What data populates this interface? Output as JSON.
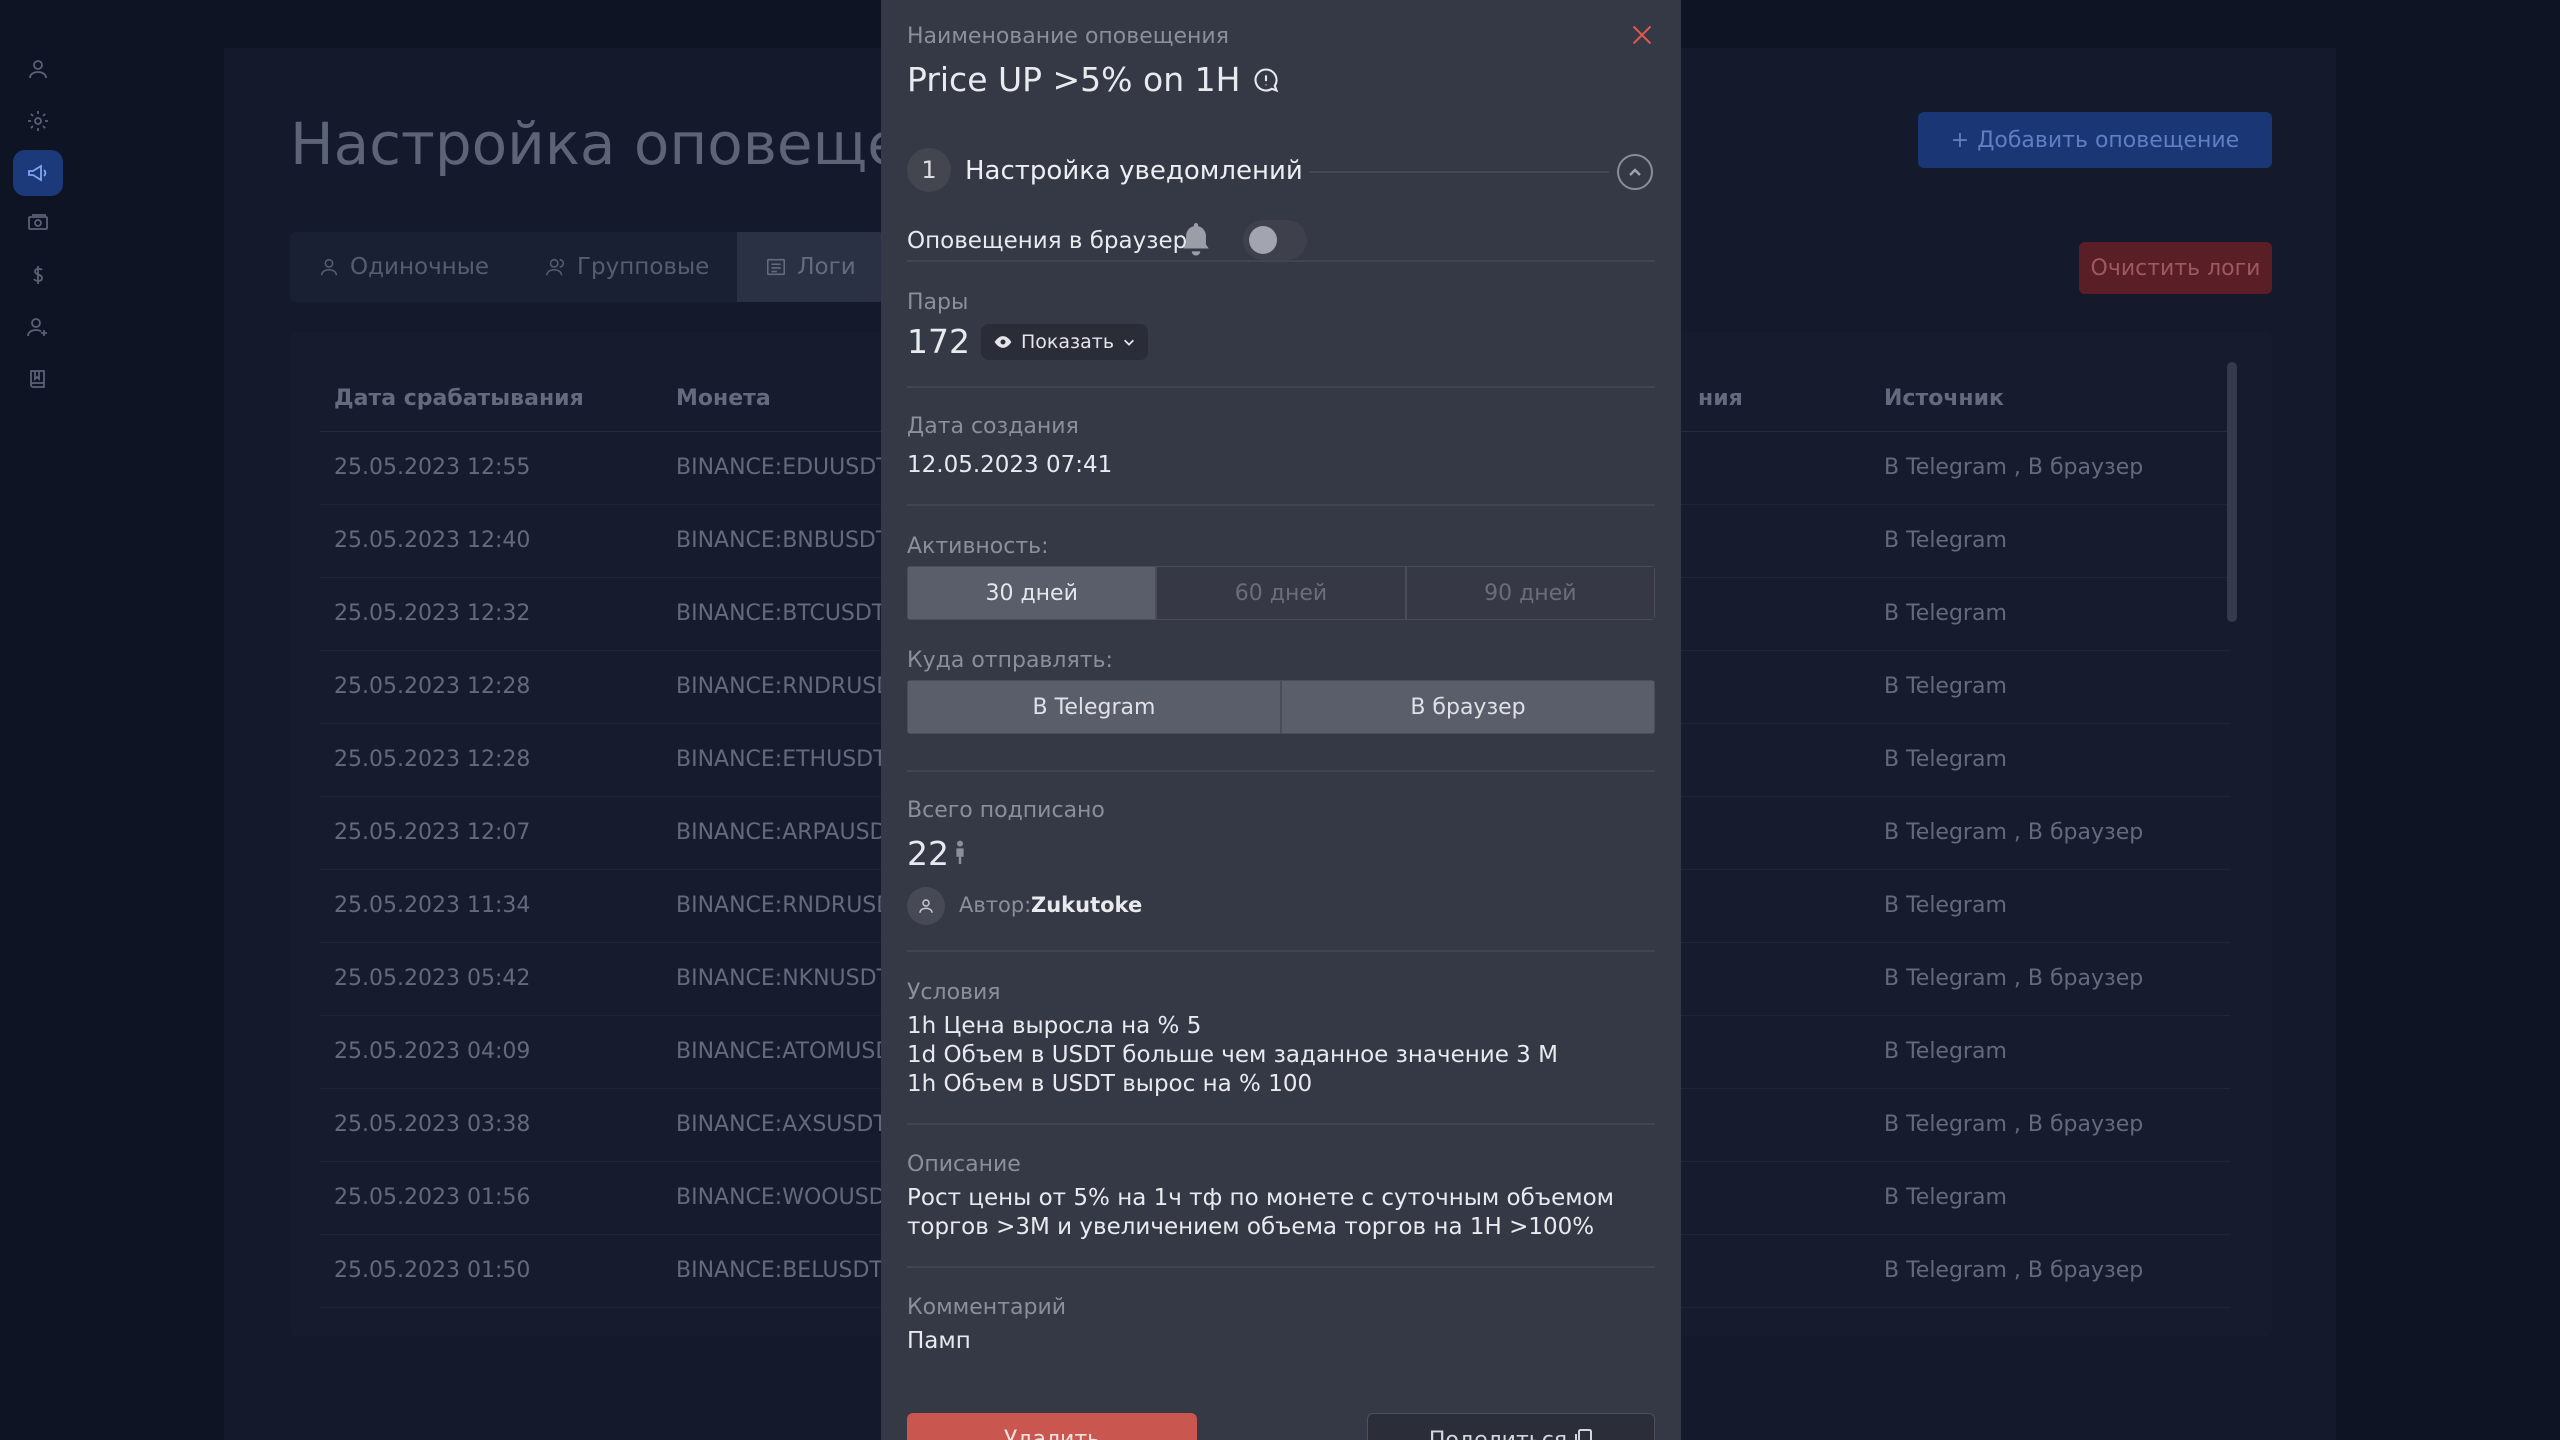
{
  "sidebar": {
    "items": [
      {
        "icon": "user-icon"
      },
      {
        "icon": "gear-icon"
      },
      {
        "icon": "megaphone-icon",
        "active": true
      },
      {
        "icon": "cash-icon"
      },
      {
        "icon": "dollar-icon"
      },
      {
        "icon": "add-user-icon"
      },
      {
        "icon": "book-icon"
      }
    ]
  },
  "page": {
    "title": "Настройка оповещен",
    "add_button": "Добавить оповещение",
    "clear_button": "Очистить логи",
    "tabs": [
      {
        "label": "Одиночные",
        "icon": "user-icon"
      },
      {
        "label": "Групповые",
        "icon": "users-icon"
      },
      {
        "label": "Логи",
        "icon": "list-icon",
        "active": true
      }
    ]
  },
  "table": {
    "headers": {
      "date": "Дата срабатывания",
      "coin": "Монета",
      "partial": "ния",
      "source": "Источник"
    },
    "rows": [
      {
        "date": "25.05.2023 12:55",
        "coin": "BINANCE:EDUUSDT",
        "source": "В Telegram , В браузер"
      },
      {
        "date": "25.05.2023 12:40",
        "coin": "BINANCE:BNBUSDT",
        "source": "В Telegram"
      },
      {
        "date": "25.05.2023 12:32",
        "coin": "BINANCE:BTCUSDT",
        "source": "В Telegram"
      },
      {
        "date": "25.05.2023 12:28",
        "coin": "BINANCE:RNDRUSDT",
        "source": "В Telegram"
      },
      {
        "date": "25.05.2023 12:28",
        "coin": "BINANCE:ETHUSDT",
        "source": "В Telegram"
      },
      {
        "date": "25.05.2023 12:07",
        "coin": "BINANCE:ARPAUSDT",
        "source": "В Telegram , В браузер"
      },
      {
        "date": "25.05.2023 11:34",
        "coin": "BINANCE:RNDRUSDT",
        "source": "В Telegram"
      },
      {
        "date": "25.05.2023 05:42",
        "coin": "BINANCE:NKNUSDT",
        "source": "В Telegram , В браузер"
      },
      {
        "date": "25.05.2023 04:09",
        "coin": "BINANCE:ATOMUSDT",
        "source": "В Telegram"
      },
      {
        "date": "25.05.2023 03:38",
        "coin": "BINANCE:AXSUSDT",
        "source": "В Telegram , В браузер"
      },
      {
        "date": "25.05.2023 01:56",
        "coin": "BINANCE:WOOUSDT",
        "source": "В Telegram"
      },
      {
        "date": "25.05.2023 01:50",
        "coin": "BINANCE:BELUSDT",
        "source": "В Telegram , В браузер"
      }
    ]
  },
  "modal": {
    "name_label": "Наименование оповещения",
    "name": "Price UP >5% on 1H",
    "step_number": "1",
    "step_title": "Настройка уведомлений",
    "browser_alerts_label": "Оповещения в браузере",
    "browser_alerts_on": false,
    "pairs_label": "Пары",
    "pairs_count": "172",
    "show_button": "Показать",
    "created_label": "Дата создания",
    "created_value": "12.05.2023 07:41",
    "activity_label": "Активность:",
    "activity_options": [
      "30 дней",
      "60 дней",
      "90 дней"
    ],
    "activity_selected": "30 дней",
    "send_to_label": "Куда отправлять:",
    "send_to_options": [
      "В Telegram",
      "В браузер"
    ],
    "subscribed_label": "Всего подписано",
    "subscribed_count": "22",
    "author_label": "Автор:",
    "author_name": "Zukutoke",
    "conditions_label": "Условия",
    "conditions": [
      "1h Цена выросла на % 5",
      "1d Объем в USDT больше чем заданное значение 3 M",
      "1h Объем в USDT вырос на % 100"
    ],
    "description_label": "Описание",
    "description_lines": [
      "Рост цены от 5% на 1ч тф по монете с суточным объемом",
      "торгов >3M и увеличением объема торгов на 1H >100%"
    ],
    "comment_label": "Комментарий",
    "comment": "Памп",
    "delete_button": "Удалить",
    "share_button": "Поделиться"
  },
  "colors": {
    "accent_blue": "#1a3674",
    "danger": "#c9574f",
    "modal_bg": "#353845",
    "page_bg": "#0f1424"
  }
}
